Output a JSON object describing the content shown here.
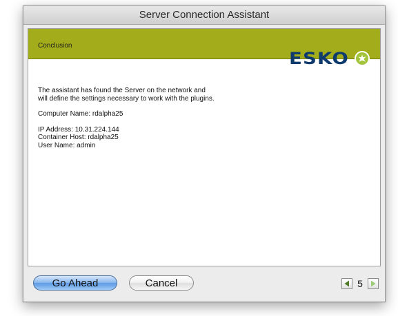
{
  "window": {
    "title": "Server Connection Assistant"
  },
  "banner": {
    "step_label": "Conclusion",
    "logo_text": "ESKO",
    "logo_icon": "esko-star-icon",
    "color": "#a3ad1b"
  },
  "body": {
    "intro_line1": "The assistant has found the Server on the network and",
    "intro_line2": "will define the settings necessary to work with the plugins.",
    "computer_name": "Computer Name:  rdalpha25",
    "ip_address": "IP Address:  10.31.224.144",
    "container_host": "Container Host: rdalpha25",
    "user_name": "User Name: admin"
  },
  "footer": {
    "primary_button": "Go Ahead",
    "cancel_button": "Cancel",
    "page_number": "5",
    "prev_icon": "triangle-left-icon",
    "next_icon": "triangle-right-icon"
  }
}
